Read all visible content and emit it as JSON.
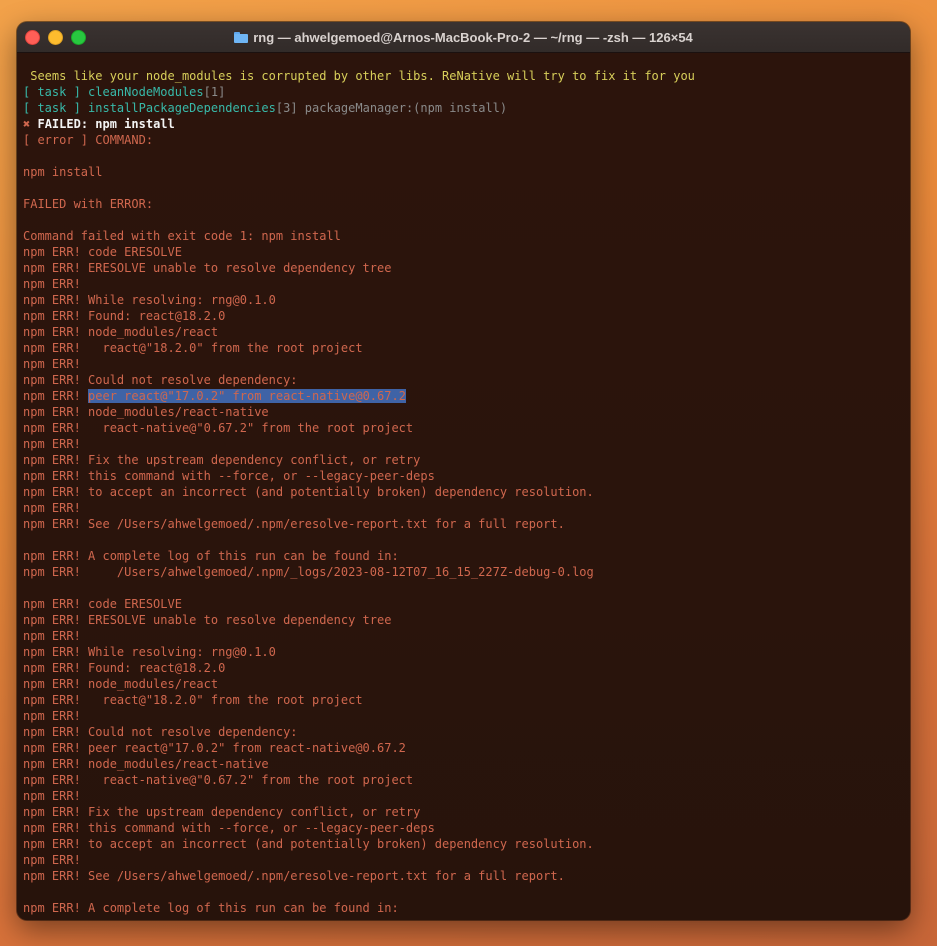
{
  "window": {
    "title": "rng — ahwelgemoed@Arnos-MacBook-Pro-2 — ~/rng — -zsh — 126×54",
    "icon": "folder-icon"
  },
  "terminal": {
    "warn": " Seems like your node_modules is corrupted by other libs. ReNative will try to fix it for you",
    "task1": {
      "bracket": "[ task ]",
      "name": "cleanNodeModules",
      "idx": "[1]"
    },
    "task2": {
      "bracket": "[ task ]",
      "name": "installPackageDependencies",
      "idx": "[3]",
      "pm": "packageManager:(npm install)"
    },
    "failed": {
      "mark": "✖",
      "text": "FAILED: npm install"
    },
    "error_cmd": "[ error ] COMMAND:",
    "blank": "",
    "npm_install": "npm install",
    "failed_with_error": "FAILED with ERROR:",
    "cmd_failed": "Command failed with exit code 1: npm install",
    "selected_prefix": "npm ERR! ",
    "selected_text": "peer react@\"17.0.2\" from react-native@0.67.2",
    "block1_a": [
      "npm ERR! code ERESOLVE",
      "npm ERR! ERESOLVE unable to resolve dependency tree",
      "npm ERR!",
      "npm ERR! While resolving: rng@0.1.0",
      "npm ERR! Found: react@18.2.0",
      "npm ERR! node_modules/react",
      "npm ERR!   react@\"18.2.0\" from the root project",
      "npm ERR!",
      "npm ERR! Could not resolve dependency:"
    ],
    "block1_b": [
      "npm ERR! node_modules/react-native",
      "npm ERR!   react-native@\"0.67.2\" from the root project",
      "npm ERR!",
      "npm ERR! Fix the upstream dependency conflict, or retry",
      "npm ERR! this command with --force, or --legacy-peer-deps",
      "npm ERR! to accept an incorrect (and potentially broken) dependency resolution.",
      "npm ERR!",
      "npm ERR! See /Users/ahwelgemoed/.npm/eresolve-report.txt for a full report.",
      "",
      "npm ERR! A complete log of this run can be found in:",
      "npm ERR!     /Users/ahwelgemoed/.npm/_logs/2023-08-12T07_16_15_227Z-debug-0.log",
      ""
    ],
    "block2": [
      "npm ERR! code ERESOLVE",
      "npm ERR! ERESOLVE unable to resolve dependency tree",
      "npm ERR!",
      "npm ERR! While resolving: rng@0.1.0",
      "npm ERR! Found: react@18.2.0",
      "npm ERR! node_modules/react",
      "npm ERR!   react@\"18.2.0\" from the root project",
      "npm ERR!",
      "npm ERR! Could not resolve dependency:",
      "npm ERR! peer react@\"17.0.2\" from react-native@0.67.2",
      "npm ERR! node_modules/react-native",
      "npm ERR!   react-native@\"0.67.2\" from the root project",
      "npm ERR!",
      "npm ERR! Fix the upstream dependency conflict, or retry",
      "npm ERR! this command with --force, or --legacy-peer-deps",
      "npm ERR! to accept an incorrect (and potentially broken) dependency resolution.",
      "npm ERR!",
      "npm ERR! See /Users/ahwelgemoed/.npm/eresolve-report.txt for a full report.",
      "",
      "npm ERR! A complete log of this run can be found in:"
    ]
  }
}
